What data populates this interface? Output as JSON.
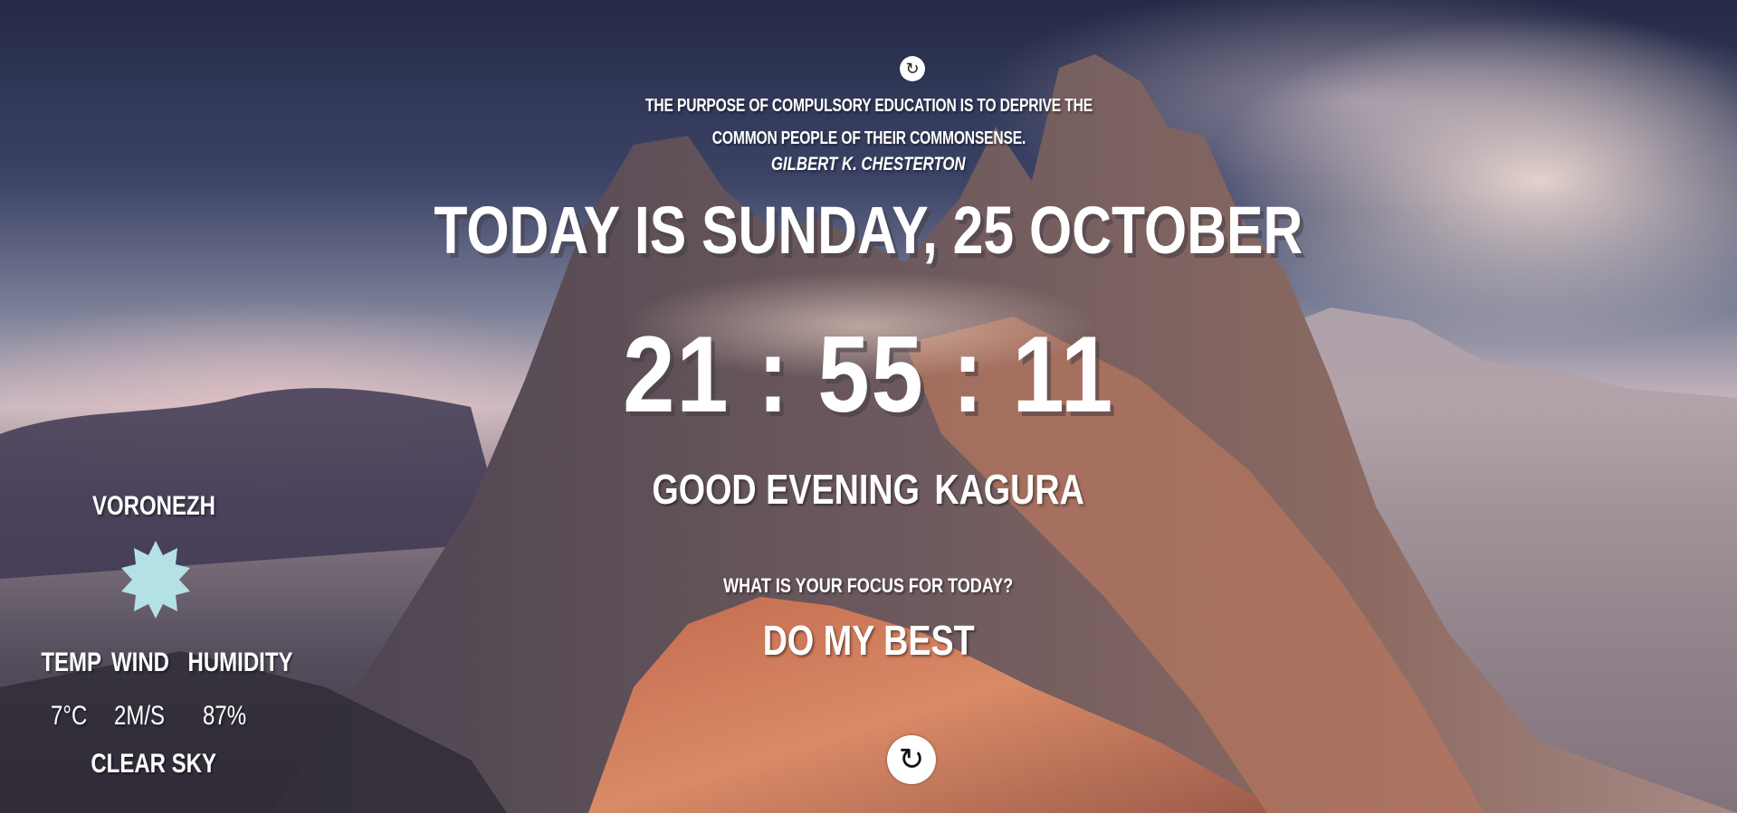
{
  "quote": {
    "text": "The purpose of compulsory education is to deprive the common people of their commonsense.",
    "author": "Gilbert K. Chesterton",
    "refresh_icon": "refresh-icon"
  },
  "date": {
    "text": "Today is Sunday, 25 October"
  },
  "clock": {
    "hours": "21",
    "minutes": "55",
    "seconds": "11",
    "separator": ":"
  },
  "greeting": {
    "salutation": "Good evening",
    "name": "Kagura"
  },
  "focus": {
    "question": "What is your focus for today?",
    "answer": "Do my best"
  },
  "weather": {
    "city": "Voronezh",
    "icon": "clear-sky-sun-icon",
    "icon_color": "#b3e1e6",
    "labels": {
      "temp": "Temp",
      "wind": "Wind",
      "humidity": "Humidity"
    },
    "values": {
      "temp": "7°C",
      "wind": "2m/s",
      "humidity": "87%"
    },
    "description": "clear sky"
  },
  "background": {
    "refresh_icon": "refresh-icon"
  }
}
